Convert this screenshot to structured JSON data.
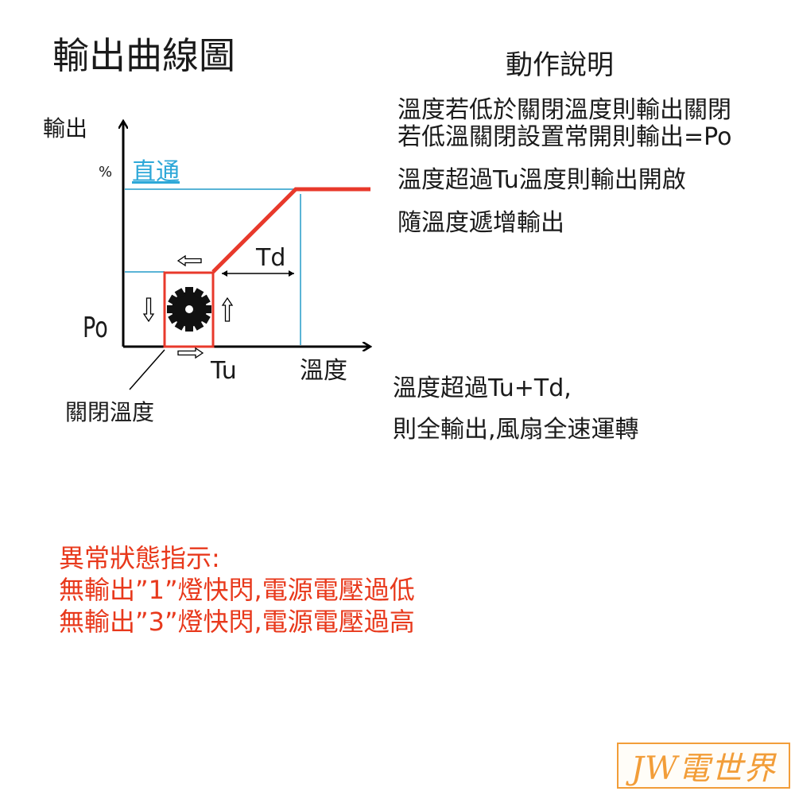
{
  "title": "輸出曲線圖",
  "section_title": "動作說明",
  "description_lines": [
    "溫度若低於關閉溫度則輸出關閉",
    "若低溫關閉設置常開則輸出=Po",
    "溫度超過Tu溫度則輸出開啟",
    "隨溫度遞增輸出"
  ],
  "full_speed_lines": [
    "溫度超過Tu+Td,",
    "則全輸出,風扇全速運轉"
  ],
  "diagram": {
    "y_axis_label": "輸出",
    "y_unit": "%",
    "bypass_label": "直通",
    "po_label": "Po",
    "td_label": "Td",
    "tu_label": "Tu",
    "x_axis_label": "溫度",
    "off_temp_label": "關閉溫度",
    "gear_icon": "gear-icon",
    "colors": {
      "curve": "#e8392b",
      "guide": "#5ab4d6",
      "axis": "#000000",
      "bypass_text": "#2ea8d8"
    }
  },
  "alerts": {
    "title": "異常狀態指示:",
    "lines": [
      "無輸出”1”燈快閃,電源電壓過低",
      "無輸出”3”燈快閃,電源電壓過高"
    ],
    "color": "#e8391c"
  },
  "logo": {
    "text": "JW電世界",
    "color": "#f29d38"
  }
}
